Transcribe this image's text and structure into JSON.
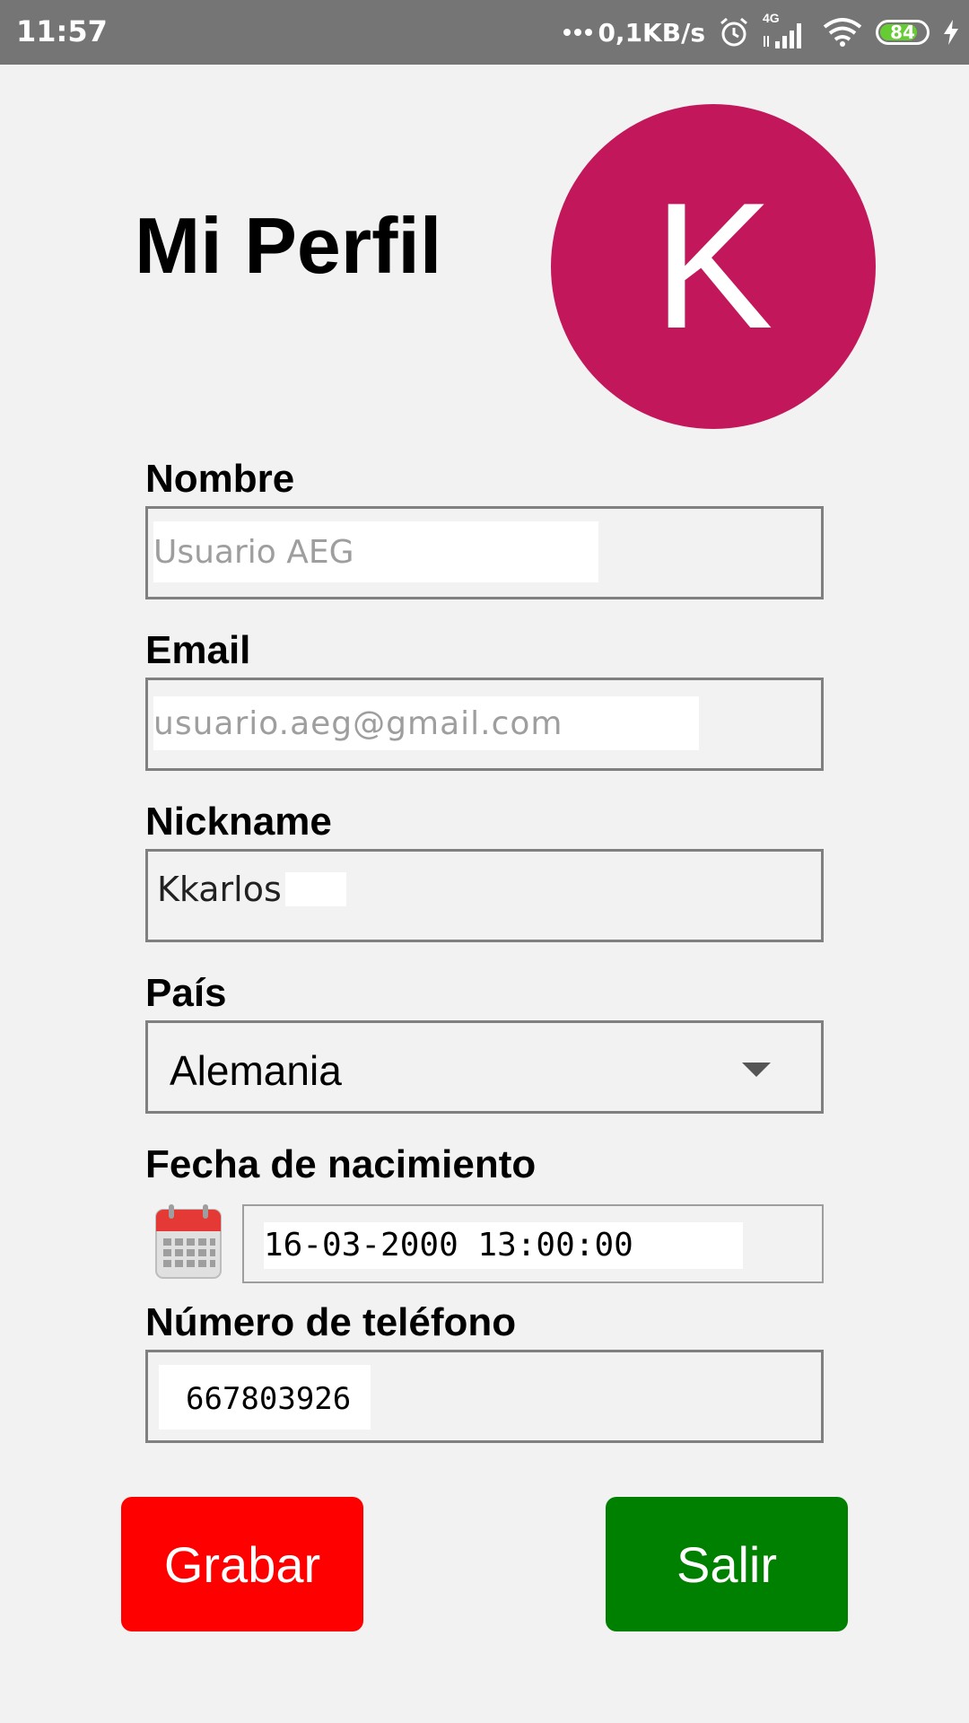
{
  "status_bar": {
    "time": "11:57",
    "net_speed": "0,1KB/s",
    "network_type": "4G",
    "battery_level": "84",
    "battery_fill": 0.84,
    "icons": [
      "alarm-icon",
      "signal-icon",
      "wifi-icon",
      "battery-icon",
      "charging-icon"
    ]
  },
  "header": {
    "title": "Mi Perfil",
    "avatar_letter": "K",
    "avatar_color": "#c2185b"
  },
  "form": {
    "nombre": {
      "label": "Nombre",
      "placeholder": "Usuario AEG"
    },
    "email": {
      "label": "Email",
      "placeholder": "usuario.aeg@gmail.com"
    },
    "nickname": {
      "label": "Nickname",
      "value": "Kkarlos"
    },
    "pais": {
      "label": "País",
      "value": "Alemania"
    },
    "fecha": {
      "label": "Fecha de nacimiento",
      "value": "16-03-2000 13:00:00",
      "icon": "calendar-icon"
    },
    "telefono": {
      "label": "Número de teléfono",
      "value": "667803926"
    }
  },
  "buttons": {
    "save_label": "Grabar",
    "save_color": "#ff0000",
    "exit_label": "Salir",
    "exit_color": "#008000"
  }
}
